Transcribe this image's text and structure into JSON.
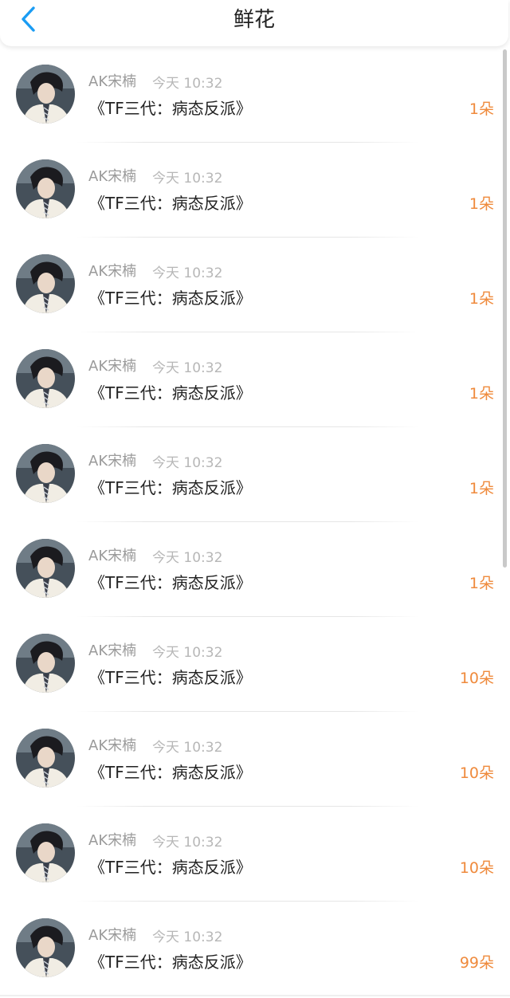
{
  "header": {
    "title": "鲜花"
  },
  "items": [
    {
      "name": "AK宋楠",
      "time": "今天 10:32",
      "book": "《TF三代：病态反派》",
      "count": "1朵"
    },
    {
      "name": "AK宋楠",
      "time": "今天 10:32",
      "book": "《TF三代：病态反派》",
      "count": "1朵"
    },
    {
      "name": "AK宋楠",
      "time": "今天 10:32",
      "book": "《TF三代：病态反派》",
      "count": "1朵"
    },
    {
      "name": "AK宋楠",
      "time": "今天 10:32",
      "book": "《TF三代：病态反派》",
      "count": "1朵"
    },
    {
      "name": "AK宋楠",
      "time": "今天 10:32",
      "book": "《TF三代：病态反派》",
      "count": "1朵"
    },
    {
      "name": "AK宋楠",
      "time": "今天 10:32",
      "book": "《TF三代：病态反派》",
      "count": "1朵"
    },
    {
      "name": "AK宋楠",
      "time": "今天 10:32",
      "book": "《TF三代：病态反派》",
      "count": "10朵"
    },
    {
      "name": "AK宋楠",
      "time": "今天 10:32",
      "book": "《TF三代：病态反派》",
      "count": "10朵"
    },
    {
      "name": "AK宋楠",
      "time": "今天 10:32",
      "book": "《TF三代：病态反派》",
      "count": "10朵"
    },
    {
      "name": "AK宋楠",
      "time": "今天 10:32",
      "book": "《TF三代：病态反派》",
      "count": "99朵"
    }
  ],
  "colors": {
    "accent": "#1a9cf3",
    "count": "#ef8a3c"
  },
  "icons": {
    "back": "chevron-left-icon"
  }
}
